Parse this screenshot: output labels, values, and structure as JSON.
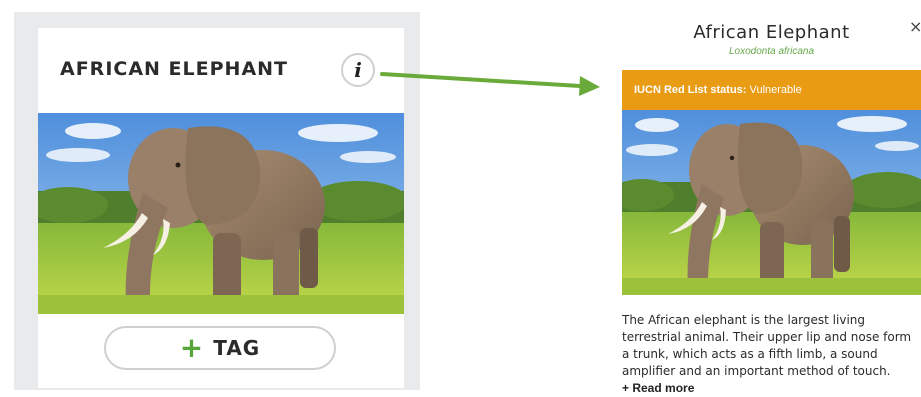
{
  "card": {
    "title": "AFRICAN ELEPHANT",
    "info_glyph": "i",
    "info_icon": "info-icon",
    "photo_icon": "elephant-photo",
    "tag_plus_glyph": "+",
    "tag_label": "TAG"
  },
  "arrow": {
    "icon": "arrow-right-icon",
    "color": "#6aaa3a"
  },
  "detail": {
    "title": "African Elephant",
    "scientific_name": "Loxodonta africana",
    "close_glyph": "×",
    "status_label": "IUCN Red List status:",
    "status_value": "Vulnerable",
    "status_color": "#e89b13",
    "description": "The African elephant is the largest living terrestrial animal. Their upper lip and nose form a trunk, which acts as a fifth limb, a sound amplifier and an important method of touch.",
    "read_more": "+ Read more"
  },
  "colors": {
    "accent_green": "#57a639",
    "subtitle_green": "#66a84a",
    "frame_gray": "#e9eaeb"
  }
}
